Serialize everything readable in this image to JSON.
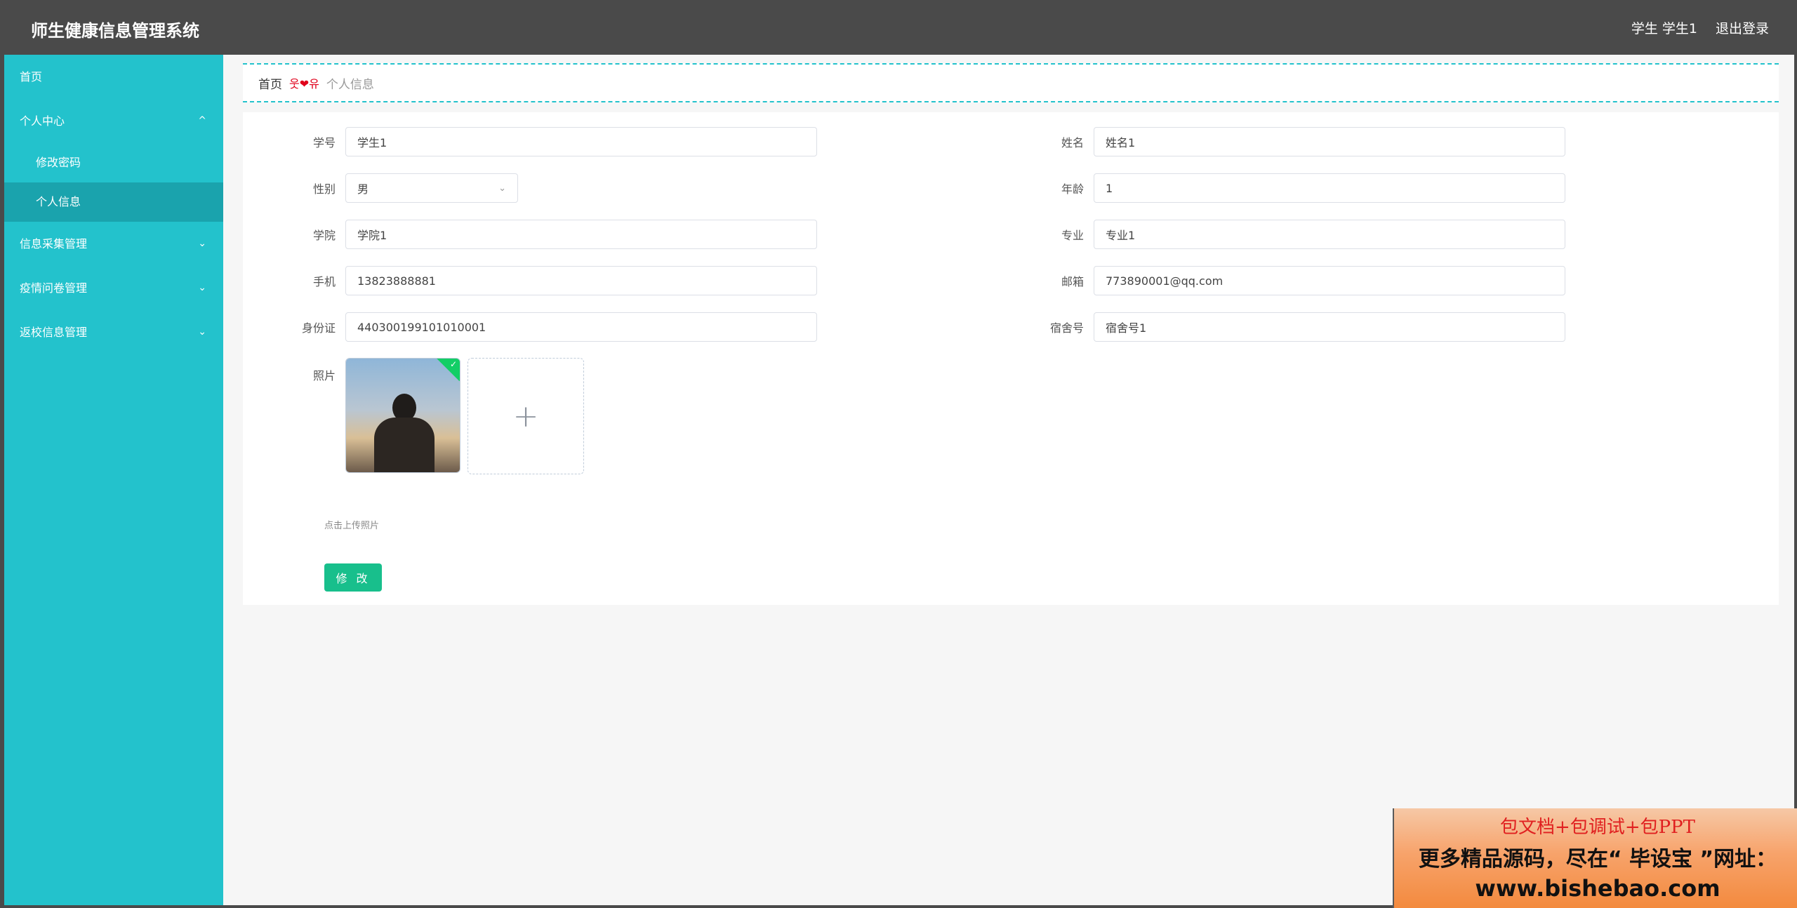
{
  "header": {
    "title": "师生健康信息管理系统",
    "user": "学生 学生1",
    "logout": "退出登录"
  },
  "sidebar": {
    "home": "首页",
    "personal_center": "个人中心",
    "change_password": "修改密码",
    "personal_info": "个人信息",
    "info_collection": "信息采集管理",
    "epidemic_survey": "疫情问卷管理",
    "return_school": "返校信息管理"
  },
  "breadcrumb": {
    "home": "首页",
    "separator": "웃❤유",
    "current": "个人信息"
  },
  "form": {
    "student_id": {
      "label": "学号",
      "value": "学生1"
    },
    "name": {
      "label": "姓名",
      "value": "姓名1"
    },
    "gender": {
      "label": "性别",
      "value": "男"
    },
    "age": {
      "label": "年龄",
      "value": "1"
    },
    "college": {
      "label": "学院",
      "value": "学院1"
    },
    "major": {
      "label": "专业",
      "value": "专业1"
    },
    "phone": {
      "label": "手机",
      "value": "13823888881"
    },
    "email": {
      "label": "邮箱",
      "value": "773890001@qq.com"
    },
    "id_card": {
      "label": "身份证",
      "value": "440300199101010001"
    },
    "dorm": {
      "label": "宿舍号",
      "value": "宿舍号1"
    },
    "photo": {
      "label": "照片",
      "hint": "点击上传照片",
      "plus": "+"
    },
    "submit": "修 改"
  },
  "icons": {
    "chevron_up": "^",
    "chevron_down": "⌄",
    "check": "✓"
  },
  "watermark": {
    "line1": "包文档+包调试+包PPT",
    "line2": "更多精品源码，尽在“ 毕设宝 ”网址：",
    "line3": "www.bishebao.com"
  },
  "colors": {
    "sidebar": "#23c2cc",
    "sidebar_active": "#1aa3ad",
    "topbar": "#4a4a4a",
    "button": "#18bf8c"
  }
}
